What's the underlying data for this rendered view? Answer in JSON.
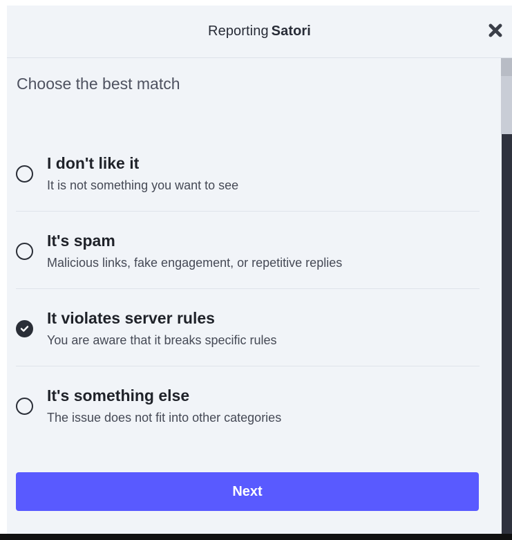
{
  "header": {
    "title_prefix": "Reporting",
    "account_name": "Satori",
    "close_icon": "close-icon"
  },
  "subtitle": "Choose the best match",
  "options": [
    {
      "label": "I don't like it",
      "description": "It is not something you want to see",
      "checked": false
    },
    {
      "label": "It's spam",
      "description": "Malicious links, fake engagement, or repetitive replies",
      "checked": false
    },
    {
      "label": "It violates server rules",
      "description": "You are aware that it breaks specific rules",
      "checked": true
    },
    {
      "label": "It's something else",
      "description": "The issue does not fit into other categories",
      "checked": false
    }
  ],
  "next_button": {
    "label": "Next"
  },
  "colors": {
    "accent": "#595aff",
    "background": "#f1f4f8",
    "text": "#1f2229"
  }
}
